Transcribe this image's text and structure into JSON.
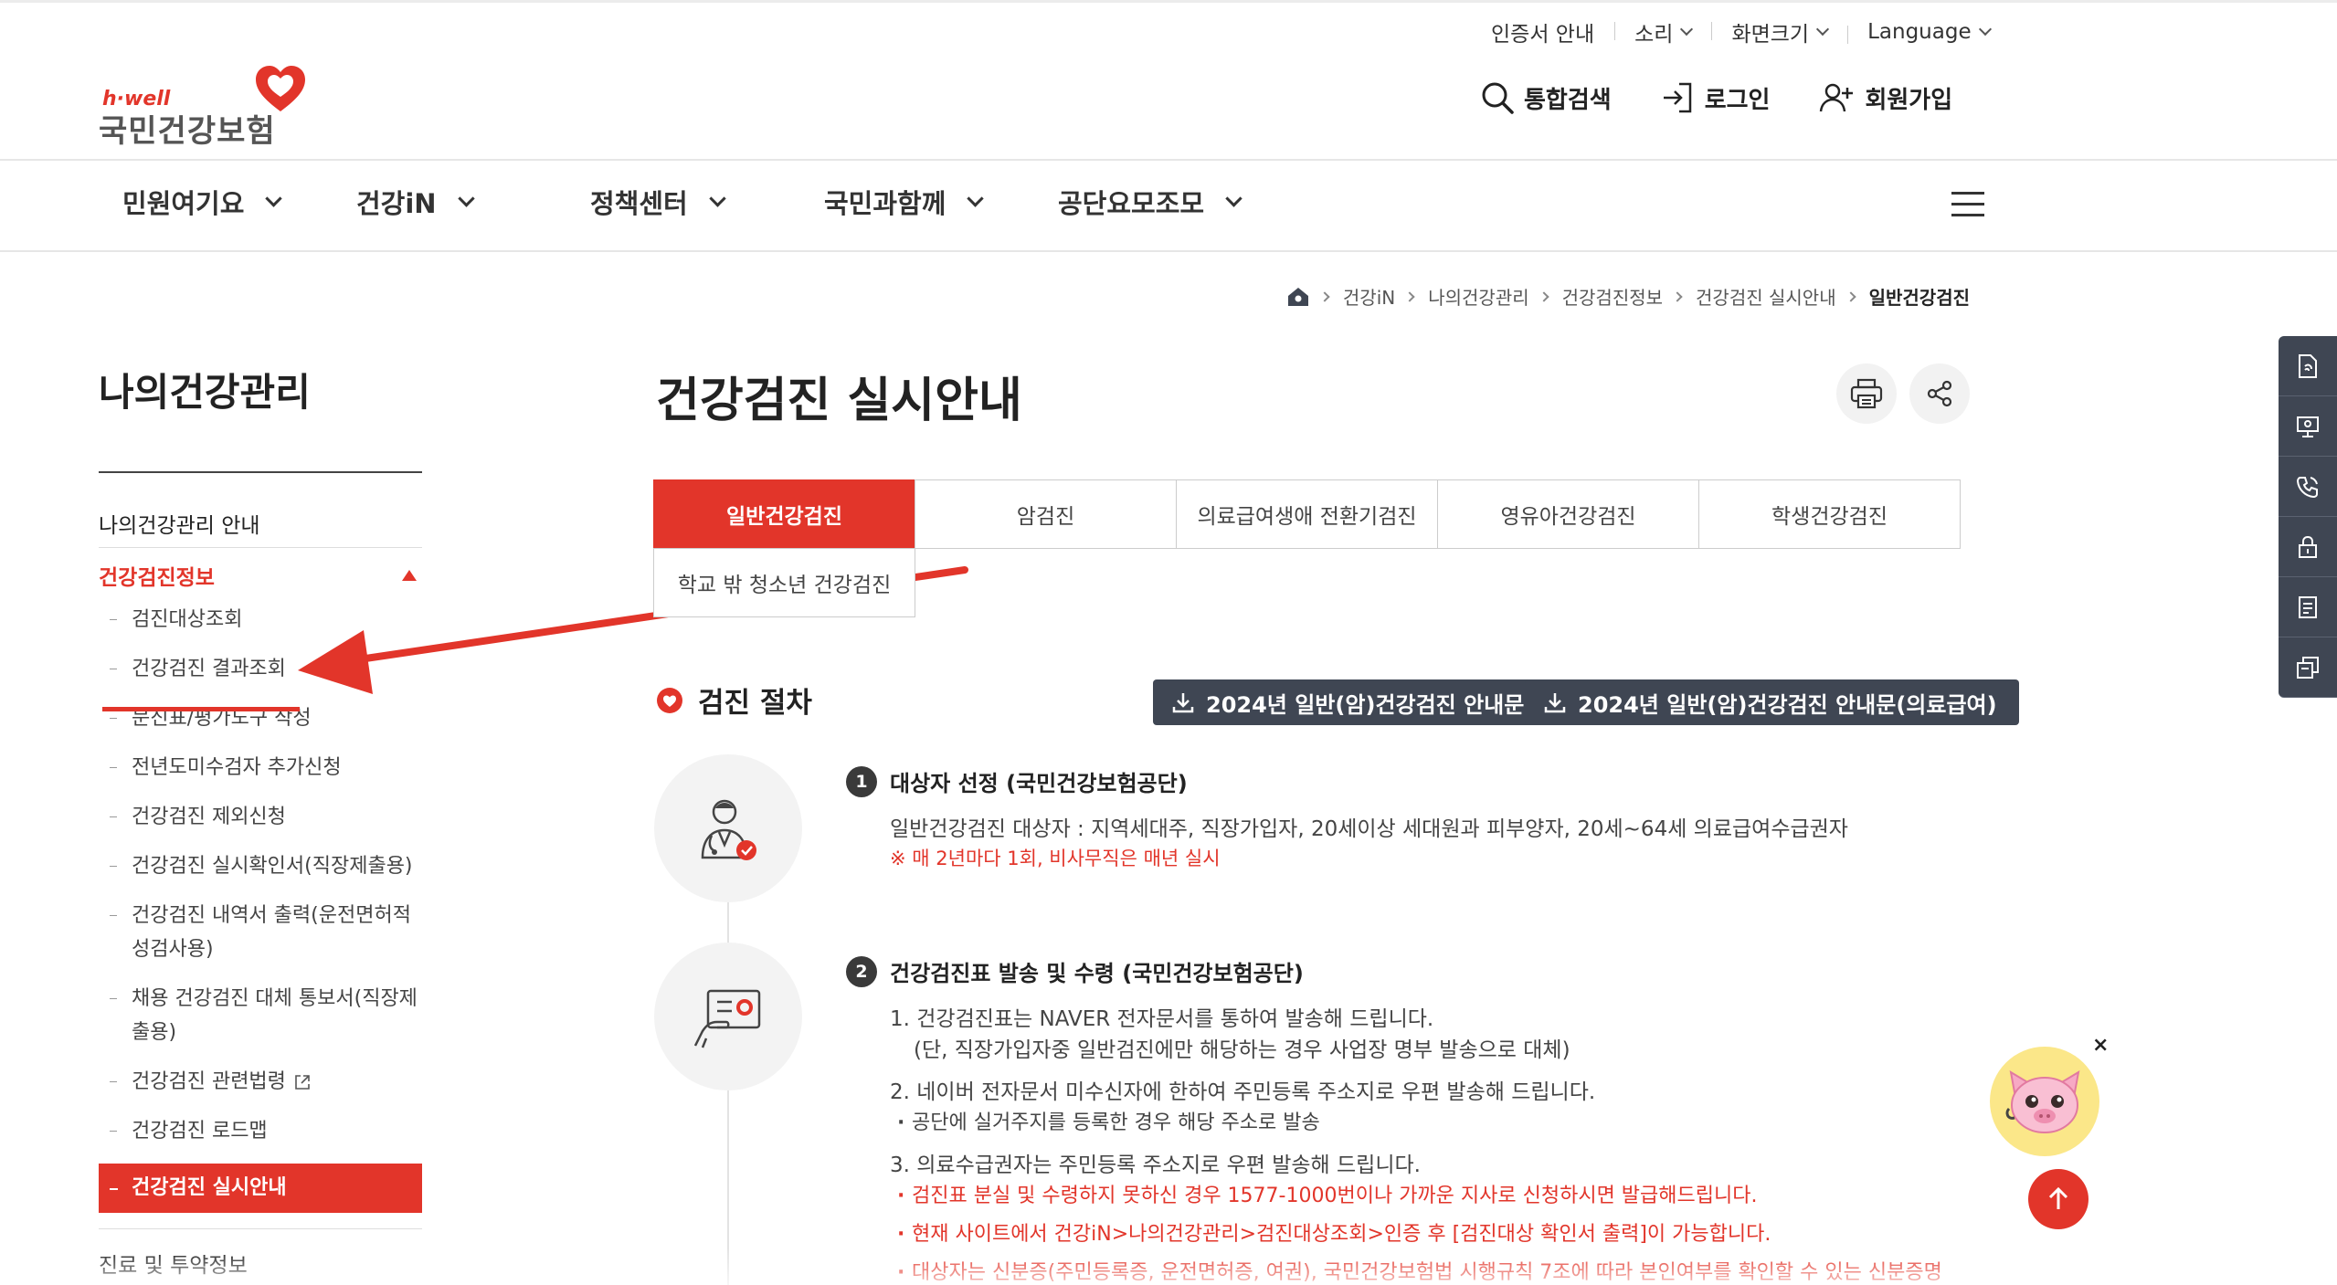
{
  "utility": {
    "cert": "인증서 안내",
    "sound": "소리",
    "screen_size": "화면크기",
    "language": "Language"
  },
  "logo": {
    "brand": "h·well",
    "name": "국민건강보험"
  },
  "top_actions": {
    "search": "통합검색",
    "login": "로그인",
    "signup": "회원가입"
  },
  "gnb": [
    "민원여기요",
    "건강iN",
    "정책센터",
    "국민과함께",
    "공단요모조모"
  ],
  "breadcrumb": [
    "건강iN",
    "나의건강관리",
    "건강검진정보",
    "건강검진 실시안내",
    "일반건강검진"
  ],
  "sidebar": {
    "title": "나의건강관리",
    "top_item": "나의건강관리 안내",
    "active_group": "건강검진정보",
    "subs": [
      "검진대상조회",
      "건강검진 결과조회",
      "문진표/평가도구 작성",
      "전년도미수검자 추가신청",
      "건강검진 제외신청",
      "건강검진 실시확인서(직장제출용)",
      "건강검진 내역서 출력(운전면허적성검사용)",
      "채용 건강검진 대체 통보서(직장제출용)",
      "건강검진 관련법령",
      "건강검진 로드맵",
      "건강검진 실시안내"
    ],
    "next_group": "진료 및 투약정보"
  },
  "page": {
    "title": "건강검진 실시안내"
  },
  "tabs": [
    "일반건강검진",
    "암검진",
    "의료급여생애 전환기검진",
    "영유아건강검진",
    "학생건강검진",
    "학교 밖 청소년 건강검진"
  ],
  "section": {
    "title": "검진 절차",
    "download1": "2024년 일반(암)건강검진 안내문",
    "download2": "2024년 일반(암)건강검진 안내문(의료급여)"
  },
  "steps": {
    "s1_num": "1",
    "s1_title": "대상자 선정 (국민건강보험공단)",
    "s1_text": "일반건강검진 대상자 : 지역세대주, 직장가입자, 20세이상 세대원과 피부양자, 20세~64세 의료급여수급권자",
    "s1_note": "※ 매 2년마다 1회, 비사무직은 매년 실시",
    "s2_num": "2",
    "s2_title": "건강검진표 발송 및 수령 (국민건강보험공단)",
    "s2_l1": "1. 건강검진표는 NAVER 전자문서를 통하여 발송해 드립니다.",
    "s2_l1b": "(단, 직장가입자중 일반검진에만 해당하는 경우 사업장 명부 발송으로 대체)",
    "s2_l2": "2. 네이버 전자문서 미수신자에 한하여 주민등록 주소지로 우편 발송해 드립니다.",
    "s2_l2b": "공단에 실거주지를 등록한 경우 해당 주소로 발송",
    "s2_l3": "3. 의료수급권자는 주민등록 주소지로 우편 발송해 드립니다.",
    "s2_l3b": "검진표 분실 및 수령하지 못하신 경우 1577-1000번이나 가까운 지사로 신청하시면 발급해드립니다.",
    "s2_l3c": "현재 사이트에서 건강iN>나의건강관리>검진대상조회>인증 후 [검진대상 확인서 출력]이 가능합니다.",
    "s2_l3d": "대상자는 신분증(주민등록증, 운전면허증, 여권), 국민건강보험법 시행규칙 7조에 따라 본인여부를 확인할 수 있는 신분증명서"
  },
  "colors": {
    "accent": "#e2352a",
    "dark": "#3f4653"
  },
  "icons": {
    "quick": [
      "document-icon",
      "monitor-icon",
      "phone-icon",
      "lock-icon",
      "note-icon",
      "copy-icon"
    ]
  }
}
